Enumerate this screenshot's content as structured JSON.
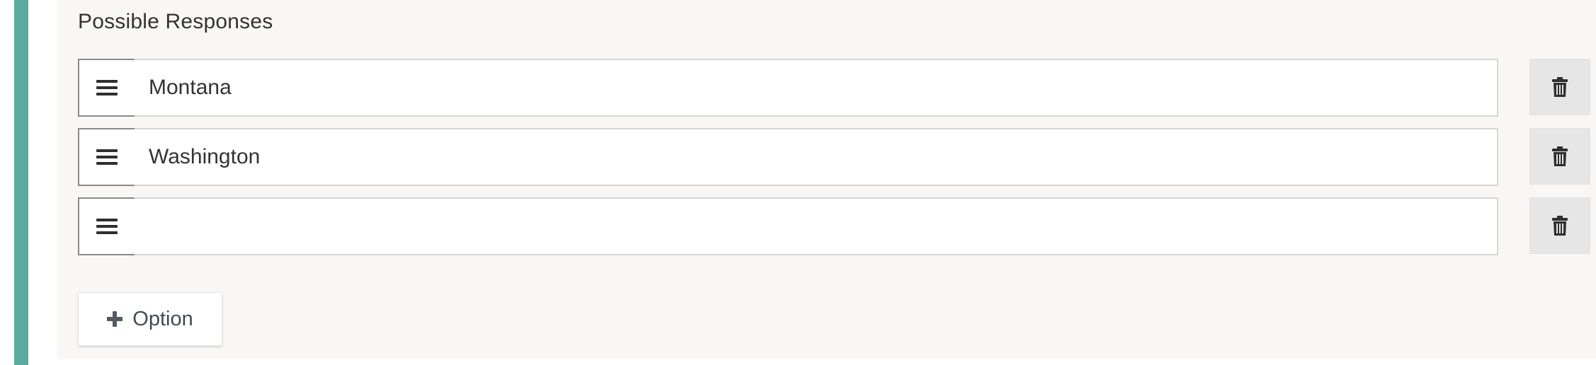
{
  "colors": {
    "accent": "#5aab9f",
    "icon_dark": "#2f2f2f",
    "plus_icon": "#555a60"
  },
  "section": {
    "title": "Possible Responses"
  },
  "options": [
    {
      "value": "Montana",
      "placeholder": ""
    },
    {
      "value": "Washington",
      "placeholder": ""
    },
    {
      "value": "",
      "placeholder": ""
    }
  ],
  "icons": {
    "drag": "hamburger-icon",
    "delete": "trash-icon",
    "add": "plus-icon"
  },
  "add_button": {
    "label": "Option"
  }
}
